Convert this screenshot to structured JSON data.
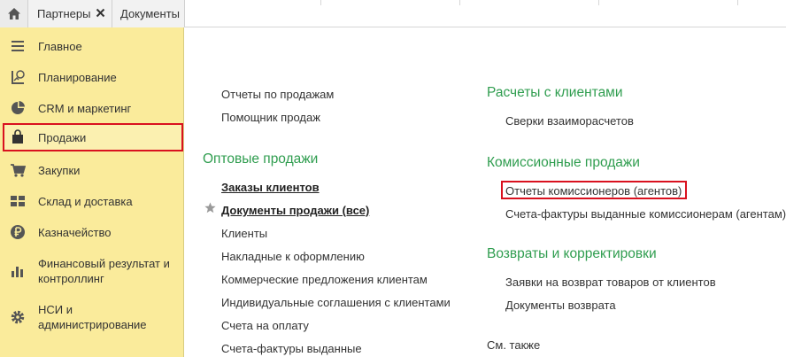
{
  "tabs": {
    "home_icon": "home-icon",
    "partners": "Партнеры",
    "documents": "Документы",
    "close_icon": "close-icon"
  },
  "sidebar": {
    "items": [
      {
        "label": "Главное",
        "icon": "menu-icon"
      },
      {
        "label": "Планирование",
        "icon": "planning-icon"
      },
      {
        "label": "CRM и маркетинг",
        "icon": "pie-chart-icon"
      },
      {
        "label": "Продажи",
        "icon": "shopping-bag-icon",
        "active": true
      },
      {
        "label": "Закупки",
        "icon": "cart-icon"
      },
      {
        "label": "Склад и доставка",
        "icon": "warehouse-icon"
      },
      {
        "label": "Казначейство",
        "icon": "ruble-icon"
      },
      {
        "label": "Финансовый результат и контроллинг",
        "icon": "bar-chart-icon"
      },
      {
        "label": "НСИ и администрирование",
        "icon": "gear-icon"
      }
    ]
  },
  "main": {
    "left_top_links": [
      "Отчеты по продажам",
      "Помощник продаж"
    ],
    "wholesale": {
      "title": "Оптовые продажи",
      "links": [
        "Заказы клиентов",
        "Документы продажи (все)",
        "Клиенты",
        "Накладные к оформлению",
        "Коммерческие предложения клиентам",
        "Индивидуальные соглашения с клиентами",
        "Счета на оплату",
        "Счета-фактуры выданные"
      ]
    },
    "settlements": {
      "title": "Расчеты с клиентами",
      "links": [
        "Сверки взаиморасчетов"
      ]
    },
    "commission": {
      "title": "Комиссионные продажи",
      "links": [
        "Отчеты комиссионеров (агентов)",
        "Счета-фактуры выданные комиссионерам (агентам)"
      ]
    },
    "returns": {
      "title": "Возвраты и корректировки",
      "links": [
        "Заявки на возврат товаров от клиентов",
        "Документы возврата"
      ]
    },
    "see_also": "См. также"
  },
  "colors": {
    "sidebar_bg": "#faeb9b",
    "section_title": "#2f9d4f",
    "highlight": "#d9111f"
  }
}
